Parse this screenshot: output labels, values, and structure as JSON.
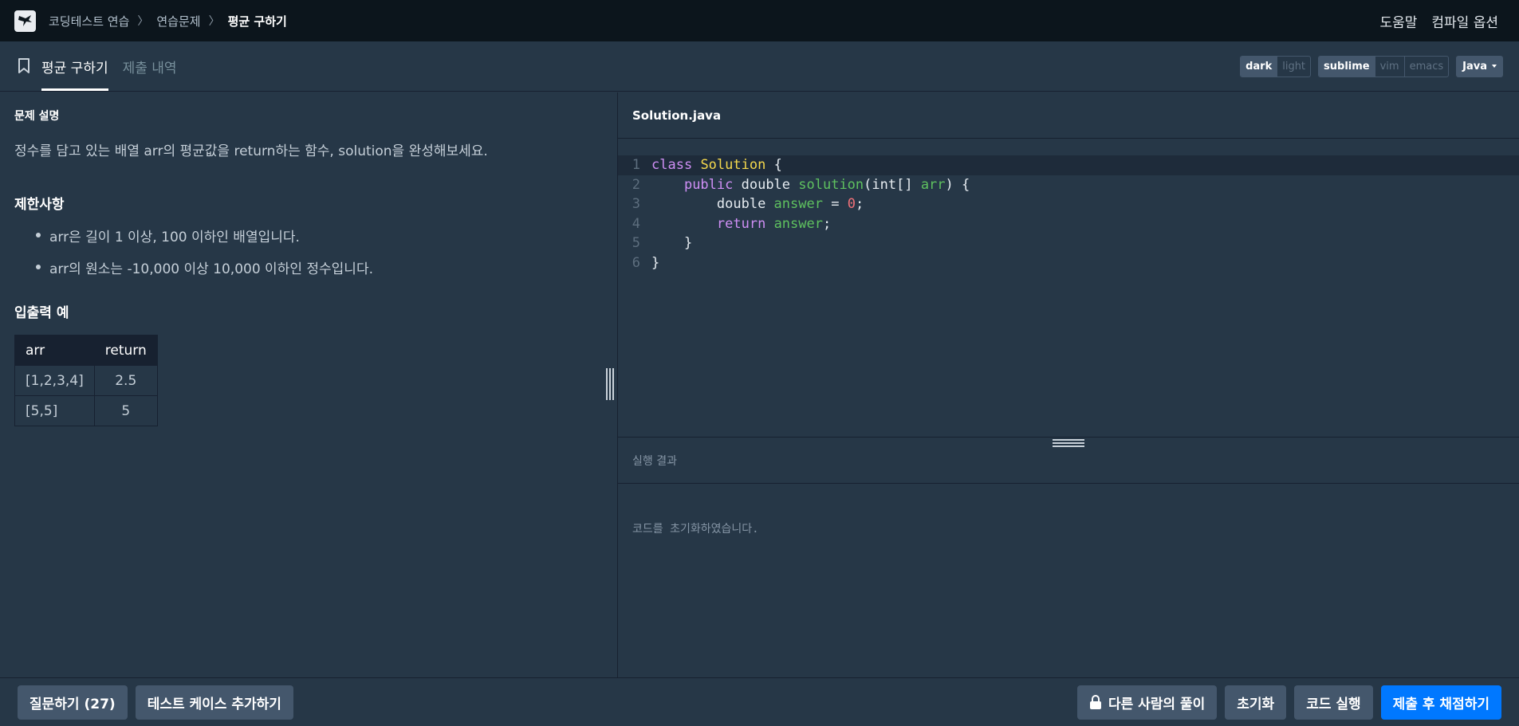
{
  "breadcrumb": {
    "items": [
      "코딩테스트 연습",
      "연습문제"
    ],
    "current": "평균 구하기"
  },
  "topnav": {
    "help": "도움말",
    "compile_options": "컴파일 옵션"
  },
  "tabs": {
    "problem": "평균 구하기",
    "submissions": "제출 내역"
  },
  "editor_options": {
    "themes": [
      "dark",
      "light"
    ],
    "active_theme": "dark",
    "keymaps": [
      "sublime",
      "vim",
      "emacs"
    ],
    "active_keymap": "sublime",
    "language": "Java"
  },
  "problem": {
    "desc_heading": "문제 설명",
    "description": "정수를 담고 있는 배열 arr의 평균값을 return하는 함수, solution을 완성해보세요.",
    "limits_heading": "제한사항",
    "limits": [
      "arr은 길이 1 이상, 100 이하인 배열입니다.",
      "arr의 원소는 -10,000 이상 10,000 이하인 정수입니다."
    ],
    "io_heading": "입출력 예",
    "io_table": {
      "headers": [
        "arr",
        "return"
      ],
      "rows": [
        [
          "[1,2,3,4]",
          "2.5"
        ],
        [
          "[5,5]",
          "5"
        ]
      ]
    }
  },
  "editor": {
    "filename": "Solution.java",
    "line_numbers": [
      "1",
      "2",
      "3",
      "4",
      "5",
      "6"
    ],
    "code": {
      "l1_kw": "class",
      "l1_cls": "Solution",
      "l1_rest": " {",
      "l2_indent": "    ",
      "l2_kw": "public",
      "l2_type": " double ",
      "l2_fn": "solution",
      "l2_p1": "(int[] ",
      "l2_var": "arr",
      "l2_p2": ") {",
      "l3_indent": "        ",
      "l3_type": "double ",
      "l3_var": "answer",
      "l3_eq": " = ",
      "l3_num": "0",
      "l3_end": ";",
      "l4_indent": "        ",
      "l4_kw": "return",
      "l4_sp": " ",
      "l4_var": "answer",
      "l4_end": ";",
      "l5": "    }",
      "l6": "}"
    }
  },
  "result": {
    "heading": "실행 결과",
    "message": "코드를 초기화하였습니다."
  },
  "bottom": {
    "ask": "질문하기 (27)",
    "add_testcase": "테스트 케이스 추가하기",
    "others_solution": "다른 사람의 풀이",
    "reset": "초기화",
    "run": "코드 실행",
    "submit": "제출 후 채점하기"
  }
}
